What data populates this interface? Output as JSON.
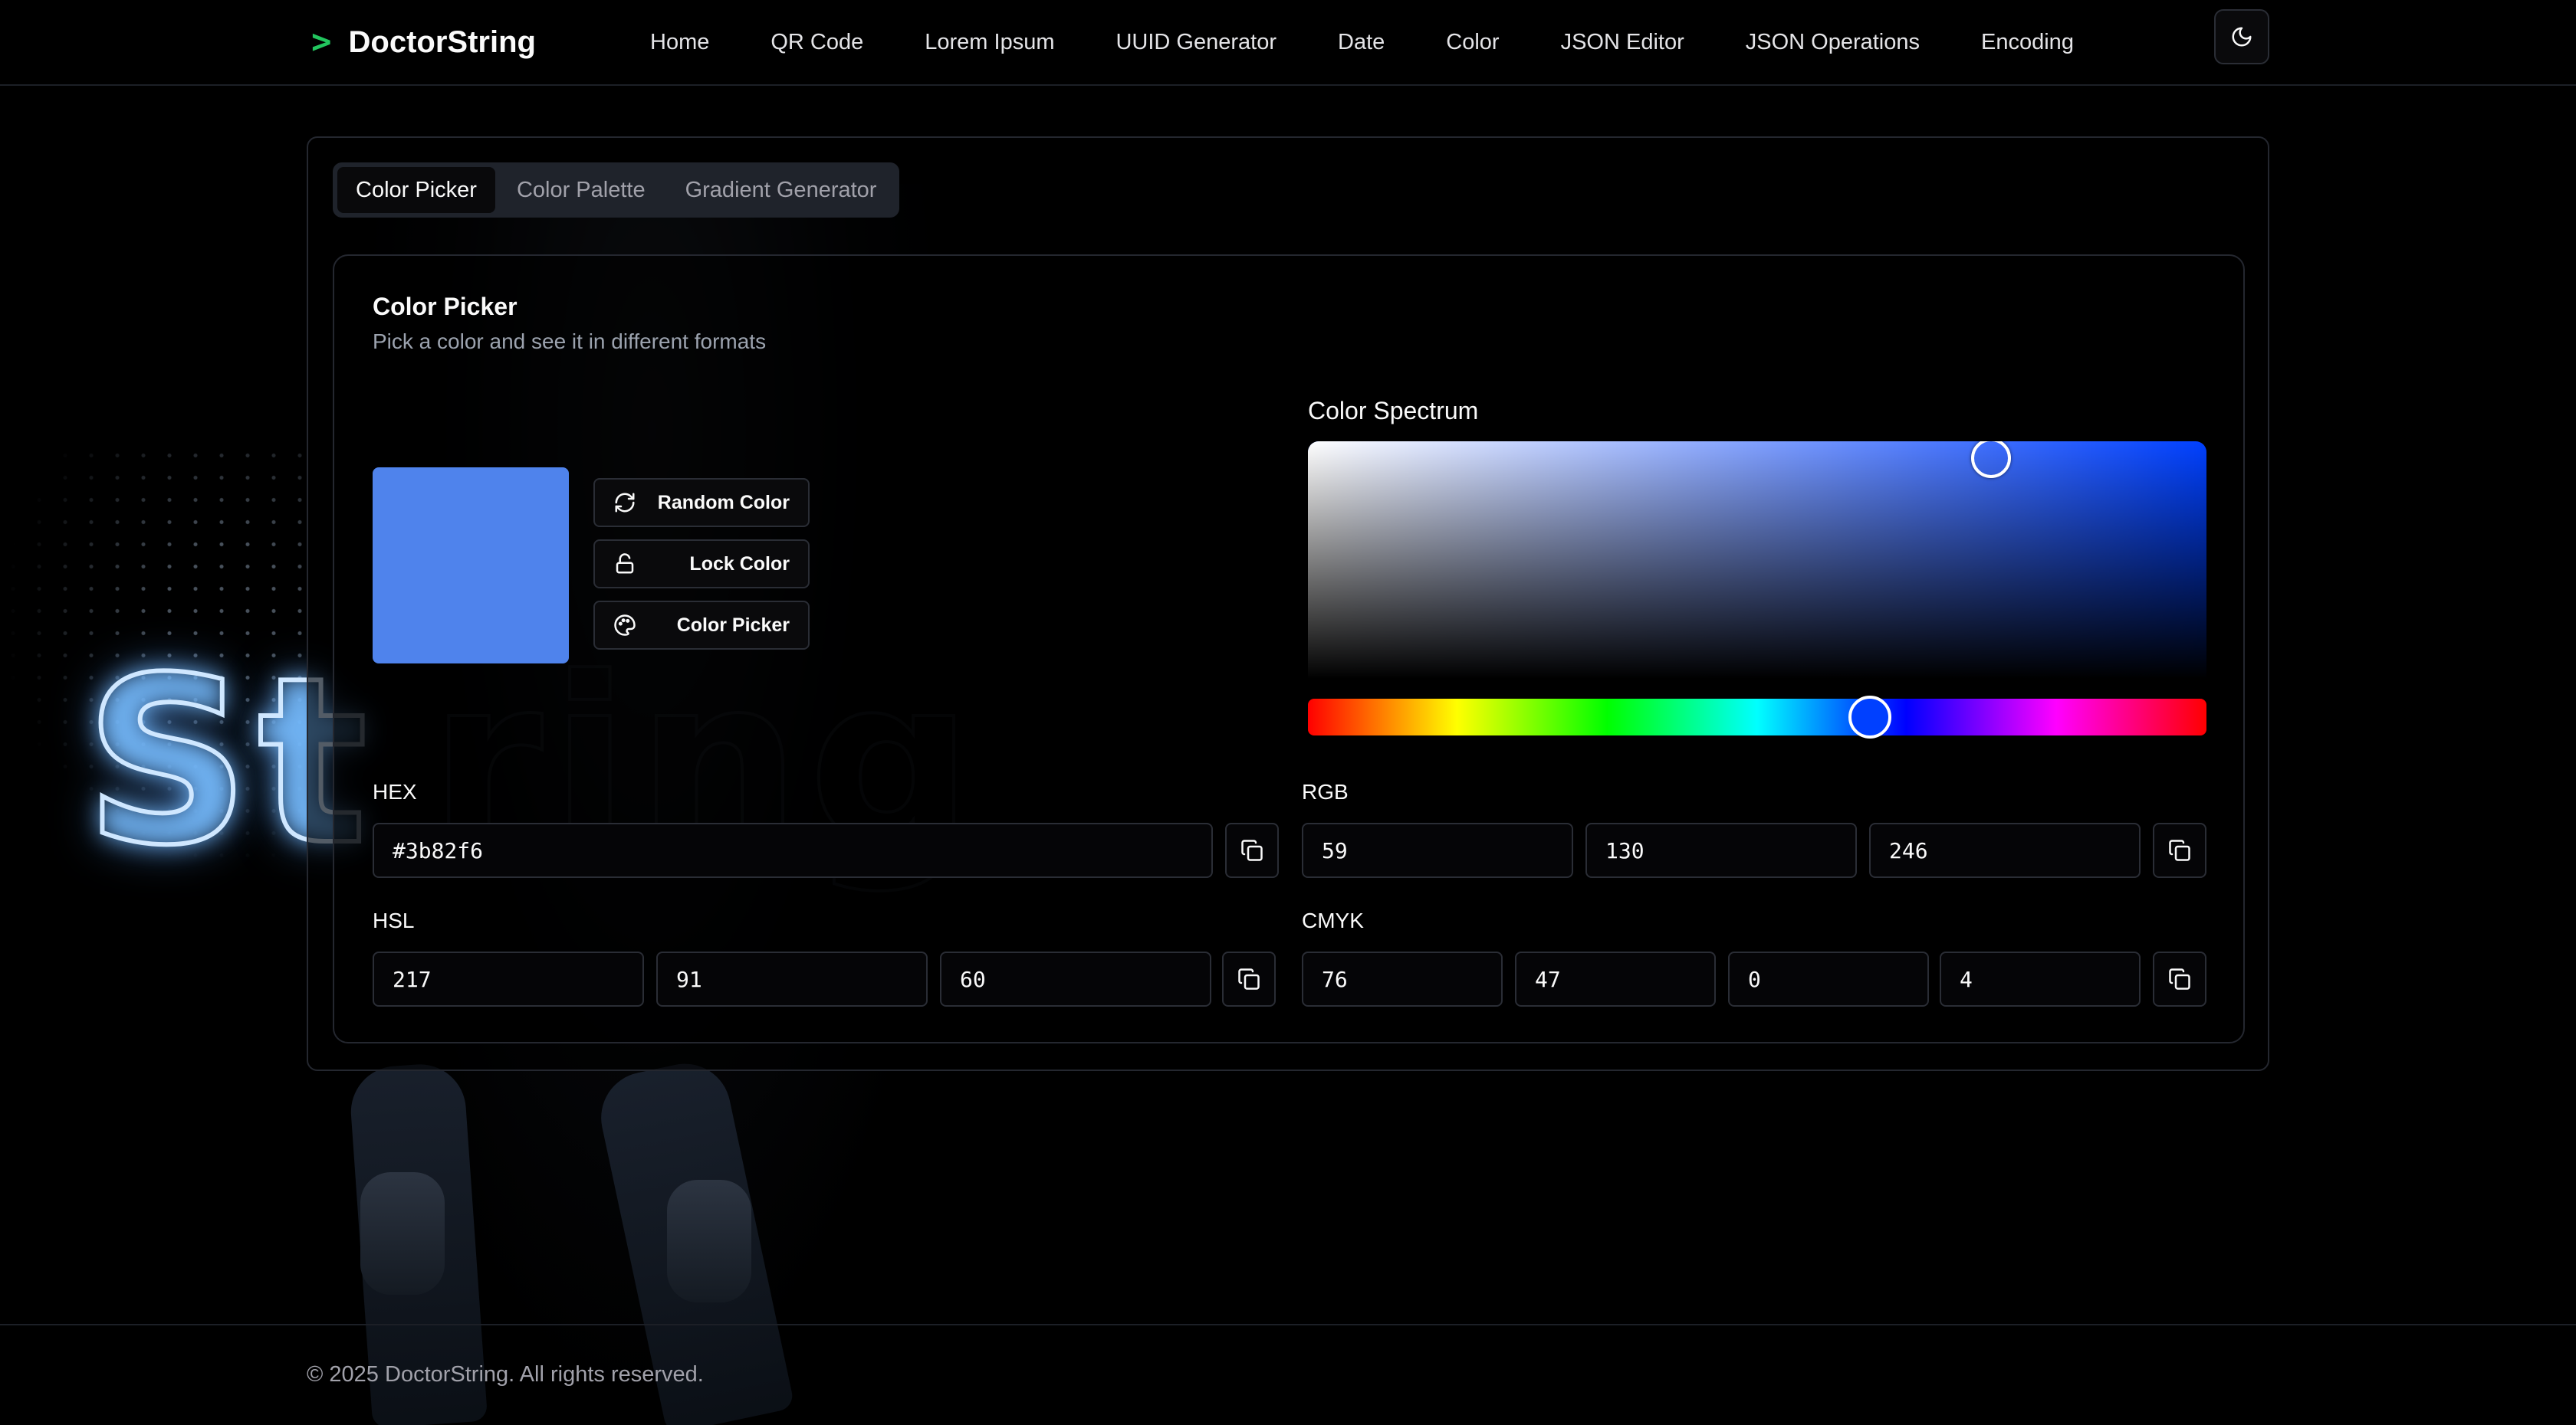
{
  "brand": {
    "icon": ">",
    "name": "DoctorString"
  },
  "nav": [
    "Home",
    "QR Code",
    "Lorem Ipsum",
    "UUID Generator",
    "Date",
    "Color",
    "JSON Editor",
    "JSON Operations",
    "Encoding"
  ],
  "theme_toggle": {
    "icon": "moon-icon"
  },
  "tabs": [
    {
      "label": "Color Picker",
      "active": true
    },
    {
      "label": "Color Palette",
      "active": false
    },
    {
      "label": "Gradient Generator",
      "active": false
    }
  ],
  "card": {
    "title": "Color Picker",
    "subtitle": "Pick a color and see it in different formats"
  },
  "current_color": "#3b82f6",
  "swatch_color": "#4f83ec",
  "actions": [
    {
      "label": "Random Color",
      "icon": "refresh-icon"
    },
    {
      "label": "Lock Color",
      "icon": "unlock-icon"
    },
    {
      "label": "Color Picker",
      "icon": "palette-icon"
    }
  ],
  "spectrum": {
    "label": "Color Spectrum",
    "hue": 225,
    "saturation": 76,
    "brightness": 96
  },
  "hex": {
    "label": "HEX",
    "value": "#3b82f6"
  },
  "rgb": {
    "label": "RGB",
    "values": [
      "59",
      "130",
      "246"
    ]
  },
  "hsl": {
    "label": "HSL",
    "values": [
      "217",
      "91",
      "60"
    ]
  },
  "cmyk": {
    "label": "CMYK",
    "values": [
      "76",
      "47",
      "0",
      "4"
    ]
  },
  "footer": {
    "text": "© 2025 DoctorString. All rights reserved."
  },
  "background_art": {
    "neon_text": "St",
    "faint_text": "ring"
  },
  "colors": {
    "accent": "#22c55e",
    "background": "#000000",
    "border": "#24272f"
  }
}
